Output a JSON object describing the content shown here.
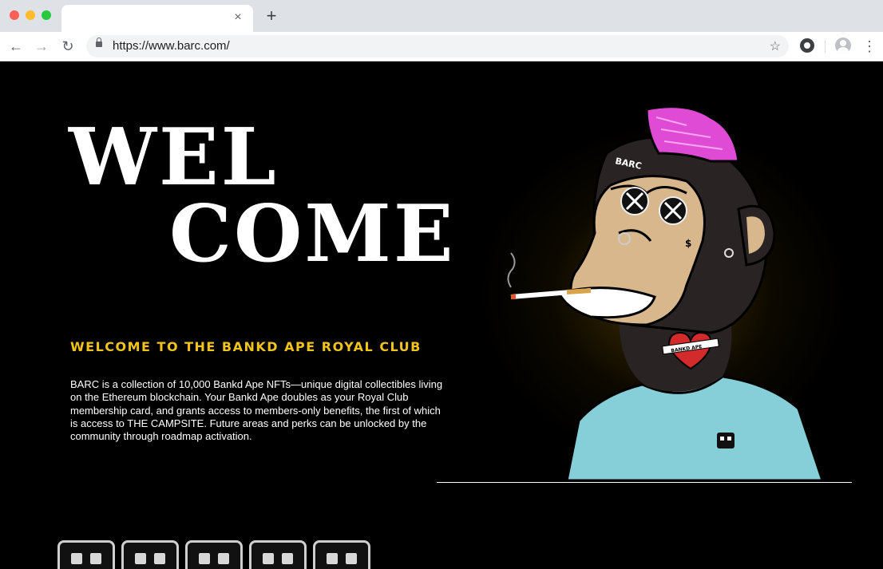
{
  "browser": {
    "tab_close": "×",
    "new_tab": "+",
    "back": "←",
    "forward": "→",
    "reload": "↻",
    "url": "https://www.barc.com/",
    "bookmark": "☆",
    "menu": "⋮"
  },
  "hero": {
    "welcome_line1": "WEL",
    "welcome_line2": "COME",
    "subheading": "WELCOME TO THE BANKD APE ROYAL CLUB",
    "description": "BARC is a collection of 10,000 Bankd Ape NFTs—unique digital collectibles living on the Ethereum blockchain. Your Bankd Ape doubles as your Royal Club membership card, and grants access to members-only benefits, the first of which is access to THE CAMPSITE. Future areas and perks can be unlocked by the community through roadmap activation."
  },
  "ape": {
    "hat_text": "BARC",
    "tattoo_text": "BANKD APE",
    "cheek_symbol": "$"
  },
  "colors": {
    "accent": "#f2c418",
    "hat": "#e04bd6",
    "shirt": "#86cfd8",
    "skin": "#d9b78d",
    "fur": "#2a2324"
  },
  "logos": [
    "logo-1",
    "logo-2",
    "logo-3",
    "logo-4",
    "logo-5"
  ]
}
